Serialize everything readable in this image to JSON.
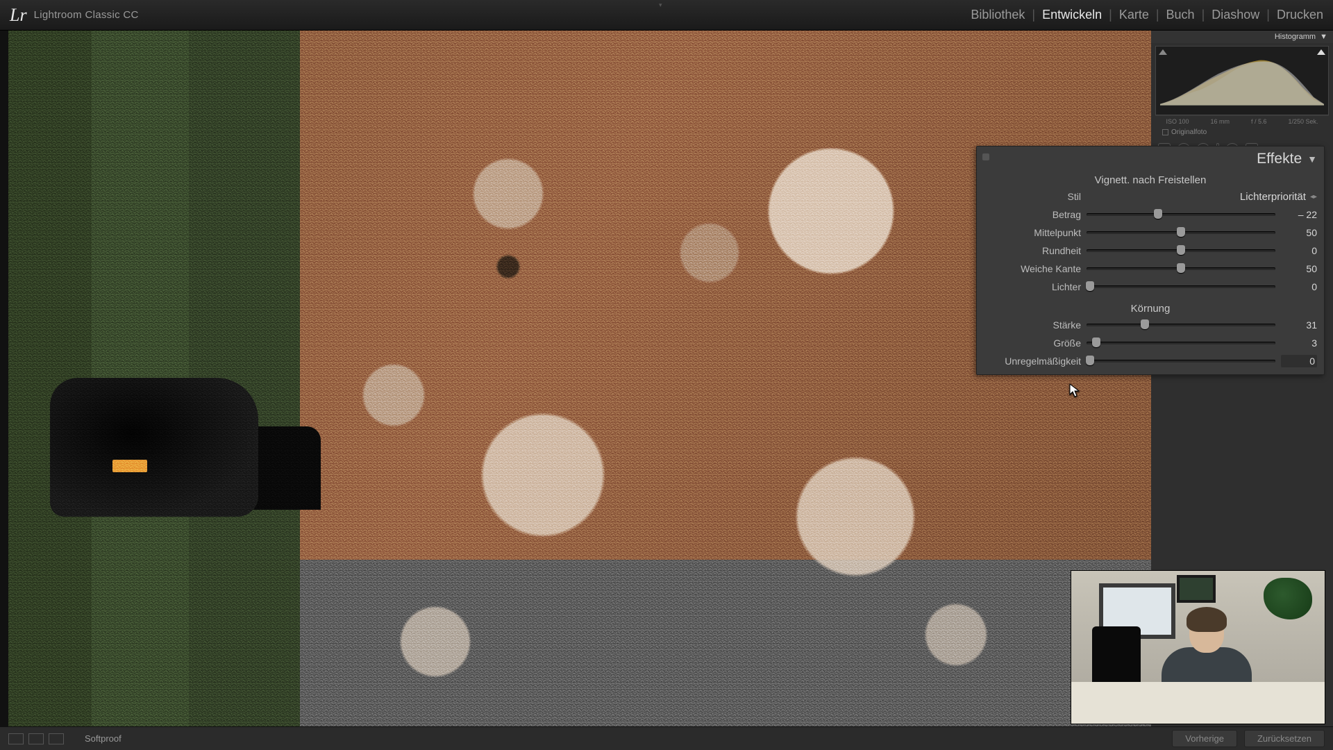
{
  "app": {
    "logo": "Lr",
    "name": "Lightroom Classic CC"
  },
  "nav": {
    "items": [
      "Bibliothek",
      "Entwickeln",
      "Karte",
      "Buch",
      "Diashow",
      "Drucken"
    ],
    "active_index": 1
  },
  "histogram": {
    "title": "Histogramm",
    "info": {
      "iso": "ISO 100",
      "focal": "16 mm",
      "aperture": "f / 5.6",
      "shutter": "1/250 Sek."
    },
    "original_label": "Originalfoto"
  },
  "panel": {
    "title": "Effekte",
    "vignette": {
      "section": "Vignett. nach Freistellen",
      "style_label": "Stil",
      "style_value": "Lichterpriorität",
      "sliders": [
        {
          "label": "Betrag",
          "value": "– 22",
          "pos": 38
        },
        {
          "label": "Mittelpunkt",
          "value": "50",
          "pos": 50
        },
        {
          "label": "Rundheit",
          "value": "0",
          "pos": 50
        },
        {
          "label": "Weiche Kante",
          "value": "50",
          "pos": 50
        },
        {
          "label": "Lichter",
          "value": "0",
          "pos": 2
        }
      ]
    },
    "grain": {
      "section": "Körnung",
      "sliders": [
        {
          "label": "Stärke",
          "value": "31",
          "pos": 31
        },
        {
          "label": "Größe",
          "value": "3",
          "pos": 5
        },
        {
          "label": "Unregelmäßigkeit",
          "value": "0",
          "pos": 2,
          "boxed": true
        }
      ]
    }
  },
  "bottom": {
    "softproof": "Softproof",
    "prev": "Vorherige",
    "reset": "Zurücksetzen"
  }
}
